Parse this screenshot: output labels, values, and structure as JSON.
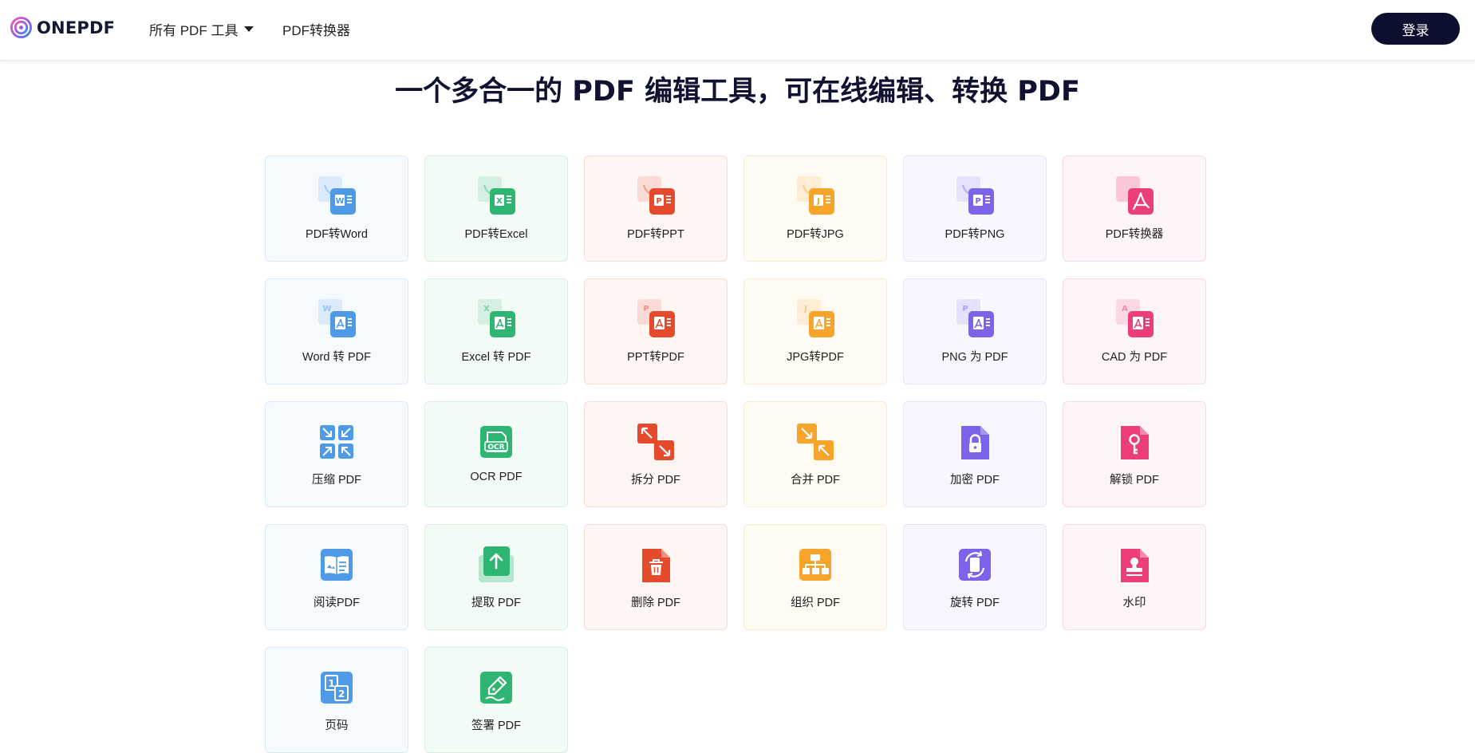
{
  "header": {
    "brand": "ONEPDF",
    "nav": [
      {
        "label": "所有 PDF 工具"
      },
      {
        "label": "PDF转换器"
      }
    ],
    "login_label": "登录"
  },
  "title": "一个多合一的 PDF 编辑工具，可在线编辑、转换 PDF",
  "colors": {
    "blue": "#4f9ae6",
    "green": "#2fb573",
    "red": "#e54a2c",
    "orange": "#f6a42a",
    "purple": "#7d63e8",
    "pink": "#ec3e78",
    "nav_dark": "#0d0f2f"
  },
  "tools": [
    {
      "label": "PDF转Word",
      "icon": "pdf-to-word-icon"
    },
    {
      "label": "PDF转Excel",
      "icon": "pdf-to-excel-icon"
    },
    {
      "label": "PDF转PPT",
      "icon": "pdf-to-ppt-icon"
    },
    {
      "label": "PDF转JPG",
      "icon": "pdf-to-jpg-icon"
    },
    {
      "label": "PDF转PNG",
      "icon": "pdf-to-png-icon"
    },
    {
      "label": "PDF转换器",
      "icon": "pdf-converter-icon"
    },
    {
      "label": "Word 转 PDF",
      "icon": "word-to-pdf-icon"
    },
    {
      "label": "Excel 转 PDF",
      "icon": "excel-to-pdf-icon"
    },
    {
      "label": "PPT转PDF",
      "icon": "ppt-to-pdf-icon"
    },
    {
      "label": "JPG转PDF",
      "icon": "jpg-to-pdf-icon"
    },
    {
      "label": "PNG 为 PDF",
      "icon": "png-to-pdf-icon"
    },
    {
      "label": "CAD 为 PDF",
      "icon": "cad-to-pdf-icon"
    },
    {
      "label": "压缩 PDF",
      "icon": "compress-icon"
    },
    {
      "label": "OCR PDF",
      "icon": "ocr-icon"
    },
    {
      "label": "拆分 PDF",
      "icon": "split-icon"
    },
    {
      "label": "合并 PDF",
      "icon": "merge-icon"
    },
    {
      "label": "加密 PDF",
      "icon": "lock-icon"
    },
    {
      "label": "解锁 PDF",
      "icon": "key-icon"
    },
    {
      "label": "阅读PDF",
      "icon": "read-icon"
    },
    {
      "label": "提取 PDF",
      "icon": "extract-icon"
    },
    {
      "label": "删除 PDF",
      "icon": "trash-icon"
    },
    {
      "label": "组织 PDF",
      "icon": "organize-icon"
    },
    {
      "label": "旋转 PDF",
      "icon": "rotate-icon"
    },
    {
      "label": "水印",
      "icon": "watermark-icon"
    },
    {
      "label": "页码",
      "icon": "page-number-icon"
    },
    {
      "label": "签署 PDF",
      "icon": "sign-icon"
    }
  ]
}
